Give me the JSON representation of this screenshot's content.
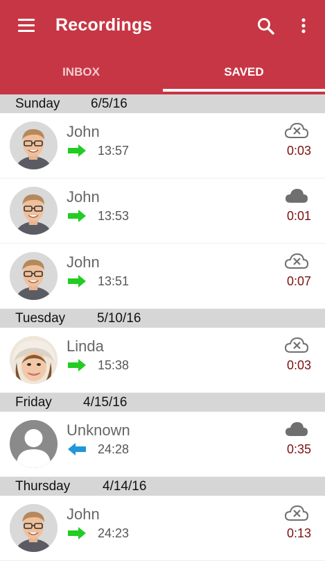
{
  "appbar": {
    "title": "Recordings",
    "menu_icon": "menu-icon",
    "search_icon": "search-icon",
    "more_icon": "more-vert-icon"
  },
  "tabs": [
    {
      "label": "INBOX"
    },
    {
      "label": "SAVED",
      "selected": true
    }
  ],
  "colors": {
    "primary": "#c73644",
    "incoming_arrow": "#22cc22",
    "outgoing_arrow": "#2196d8",
    "duration": "#7a1010"
  },
  "sections": [
    {
      "day": "Sunday",
      "date": "6/5/16",
      "items": [
        {
          "name": "John",
          "direction": "incoming",
          "time": "13:57",
          "duration": "0:03",
          "cloud": "cloud-off-icon"
        },
        {
          "name": "John",
          "direction": "incoming",
          "time": "13:53",
          "duration": "0:01",
          "cloud": "cloud-icon"
        },
        {
          "name": "John",
          "direction": "incoming",
          "time": "13:51",
          "duration": "0:07",
          "cloud": "cloud-off-icon"
        }
      ]
    },
    {
      "day": "Tuesday",
      "date": "5/10/16",
      "items": [
        {
          "name": "Linda",
          "direction": "incoming",
          "time": "15:38",
          "duration": "0:03",
          "cloud": "cloud-off-icon"
        }
      ]
    },
    {
      "day": "Friday",
      "date": "4/15/16",
      "items": [
        {
          "name": "Unknown",
          "direction": "outgoing",
          "time": "24:28",
          "duration": "0:35",
          "cloud": "cloud-icon"
        }
      ]
    },
    {
      "day": "Thursday",
      "date": "4/14/16",
      "items": [
        {
          "name": "John",
          "direction": "incoming",
          "time": "24:23",
          "duration": "0:13",
          "cloud": "cloud-off-icon"
        }
      ]
    }
  ]
}
